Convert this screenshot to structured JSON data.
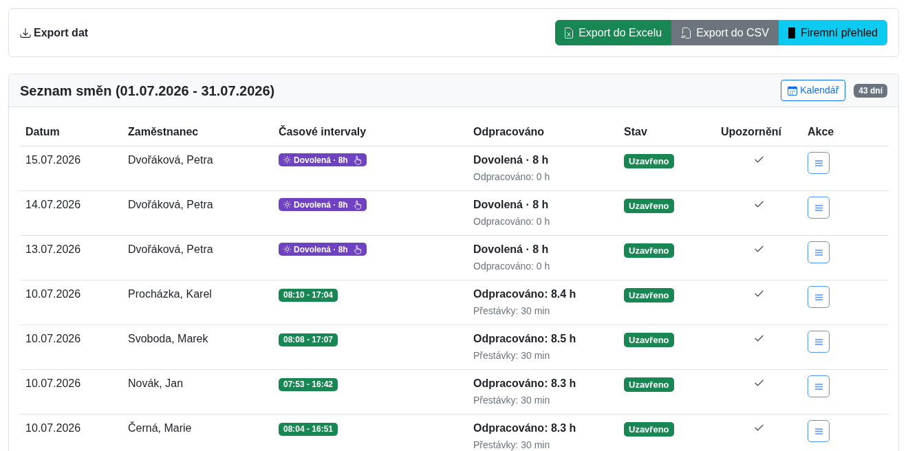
{
  "export_card": {
    "title": "Export dat",
    "buttons": [
      {
        "label": "Export do Excelu",
        "kind": "excel"
      },
      {
        "label": "Export do CSV",
        "kind": "csv"
      },
      {
        "label": "Firemní přehled",
        "kind": "overview"
      }
    ]
  },
  "shift_list": {
    "title": "Seznam směn (01.07.2026 - 31.07.2026)",
    "calendar_button": "Kalendář",
    "day_count": "43 dní",
    "columns": [
      "Datum",
      "Zaměstnanec",
      "Časové intervaly",
      "Odpracováno",
      "Stav",
      "Upozornění",
      "Akce"
    ],
    "rows": [
      {
        "date": "15.07.2026",
        "employee": "Dvořáková, Petra",
        "interval": {
          "kind": "leave",
          "label": "Dovolená · 8h"
        },
        "worked": "Dovolená · 8 h",
        "worked_detail": "Odpracováno: 0 h",
        "status": {
          "kind": "closed",
          "label": "Uzavřeno"
        },
        "warning": false
      },
      {
        "date": "14.07.2026",
        "employee": "Dvořáková, Petra",
        "interval": {
          "kind": "leave",
          "label": "Dovolená · 8h"
        },
        "worked": "Dovolená · 8 h",
        "worked_detail": "Odpracováno: 0 h",
        "status": {
          "kind": "closed",
          "label": "Uzavřeno"
        },
        "warning": false
      },
      {
        "date": "13.07.2026",
        "employee": "Dvořáková, Petra",
        "interval": {
          "kind": "leave",
          "label": "Dovolená · 8h"
        },
        "worked": "Dovolená · 8 h",
        "worked_detail": "Odpracováno: 0 h",
        "status": {
          "kind": "closed",
          "label": "Uzavřeno"
        },
        "warning": false
      },
      {
        "date": "10.07.2026",
        "employee": "Procházka, Karel",
        "interval": {
          "kind": "shift",
          "label": "08:10 - 17:04"
        },
        "worked": "Odpracováno: 8.4 h",
        "worked_detail": "Přestávky: 30 min",
        "status": {
          "kind": "closed",
          "label": "Uzavřeno"
        },
        "warning": false
      },
      {
        "date": "10.07.2026",
        "employee": "Svoboda, Marek",
        "interval": {
          "kind": "shift",
          "label": "08:08 - 17:07"
        },
        "worked": "Odpracováno: 8.5 h",
        "worked_detail": "Přestávky: 30 min",
        "status": {
          "kind": "closed",
          "label": "Uzavřeno"
        },
        "warning": false
      },
      {
        "date": "10.07.2026",
        "employee": "Novák, Jan",
        "interval": {
          "kind": "shift",
          "label": "07:53 - 16:42"
        },
        "worked": "Odpracováno: 8.3 h",
        "worked_detail": "Přestávky: 30 min",
        "status": {
          "kind": "closed",
          "label": "Uzavřeno"
        },
        "warning": false
      },
      {
        "date": "10.07.2026",
        "employee": "Černá, Marie",
        "interval": {
          "kind": "shift",
          "label": "08:04 - 16:51"
        },
        "worked": "Odpracováno: 8.3 h",
        "worked_detail": "Přestávky: 30 min",
        "status": {
          "kind": "closed",
          "label": "Uzavřeno"
        },
        "warning": false
      }
    ]
  }
}
